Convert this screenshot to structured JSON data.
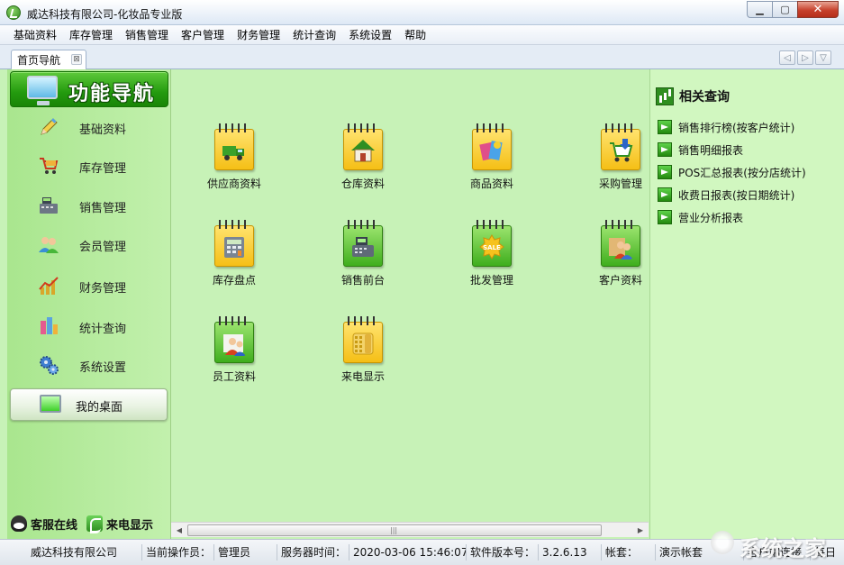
{
  "window": {
    "title": "威达科技有限公司-化妆品专业版",
    "controls": [
      "minimize",
      "maximize",
      "close"
    ]
  },
  "menu": [
    "基础资料",
    "库存管理",
    "销售管理",
    "客户管理",
    "财务管理",
    "统计查询",
    "系统设置",
    "帮助"
  ],
  "tabs": [
    {
      "label": "首页导航",
      "close": "⊠"
    }
  ],
  "sidebar": {
    "header": "功能导航",
    "items": [
      {
        "label": "基础资料",
        "icon": "pencil-icon"
      },
      {
        "label": "库存管理",
        "icon": "shopping-cart-icon"
      },
      {
        "label": "销售管理",
        "icon": "cash-register-icon"
      },
      {
        "label": "会员管理",
        "icon": "members-icon"
      },
      {
        "label": "财务管理",
        "icon": "finance-chart-icon"
      },
      {
        "label": "统计查询",
        "icon": "statistics-icon"
      },
      {
        "label": "系统设置",
        "icon": "gears-icon"
      }
    ],
    "desktop": "我的桌面",
    "bottom": {
      "support": "客服在线",
      "caller": "来电显示"
    }
  },
  "tiles": [
    {
      "label": "供应商资料",
      "icon": "supplier-truck-icon",
      "color": "yellow"
    },
    {
      "label": "仓库资料",
      "icon": "warehouse-house-icon",
      "color": "yellow"
    },
    {
      "label": "商品资料",
      "icon": "product-icon",
      "color": "yellow"
    },
    {
      "label": "采购管理",
      "icon": "purchase-cart-icon",
      "color": "yellow"
    },
    {
      "label": "库存盘点",
      "icon": "inventory-calculator-icon",
      "color": "yellow"
    },
    {
      "label": "销售前台",
      "icon": "pos-register-icon",
      "color": "green"
    },
    {
      "label": "批发管理",
      "icon": "wholesale-sale-icon",
      "color": "green"
    },
    {
      "label": "客户资料",
      "icon": "customers-icon",
      "color": "green"
    },
    {
      "label": "员工资料",
      "icon": "employee-icon",
      "color": "green"
    },
    {
      "label": "来电显示",
      "icon": "caller-phone-icon",
      "color": "yellow"
    }
  ],
  "related": {
    "title": "相关查询",
    "links": [
      "销售排行榜(按客户统计)",
      "销售明细报表",
      "POS汇总报表(按分店统计)",
      "收费日报表(按日期统计)",
      "营业分析报表"
    ]
  },
  "status": {
    "company": "威达科技有限公司",
    "operator_label": "当前操作员：",
    "operator": "管理员",
    "server_time_label": "服务器时间：",
    "server_time": "2020-03-06 15:46:07",
    "version_label": "软件版本号：",
    "version": "3.2.6.13",
    "account_label": "帐套：",
    "account": "演示帐套",
    "client_label": "客户端连接",
    "daily": "每日"
  },
  "watermark": "系统之家",
  "colors": {
    "content_bg": "#c7f2b7",
    "sidebar_bg": "#a9e68e",
    "header_green": "#239a0e",
    "tile_yellow": "#f5bf16",
    "tile_green": "#3fae1d"
  }
}
